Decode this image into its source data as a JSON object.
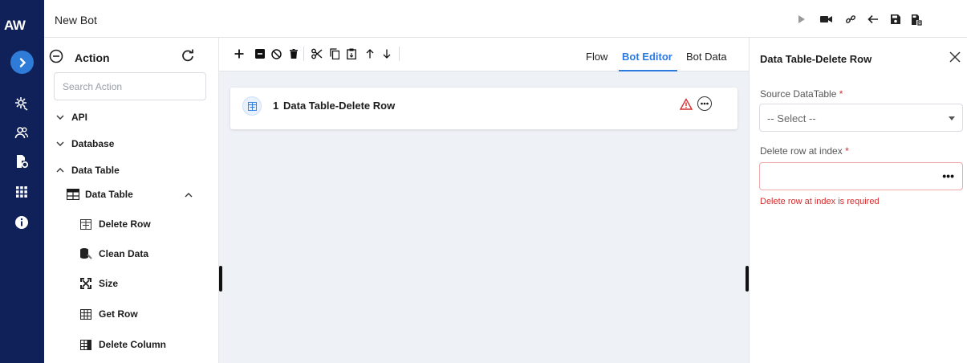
{
  "rail": {
    "logo": "AW",
    "icons": [
      "expand-icon",
      "automation-gear-icon",
      "users-icon",
      "file-settings-icon",
      "apps-grid-icon",
      "info-icon"
    ]
  },
  "topbar": {
    "title": "New Bot",
    "tools": [
      "play-icon",
      "record-icon",
      "link-icon",
      "back-arrow-icon",
      "save-icon",
      "save-as-icon"
    ]
  },
  "actions": {
    "title": "Action",
    "search_placeholder": "Search Action",
    "categories": [
      {
        "label": "API"
      },
      {
        "label": "Database"
      },
      {
        "label": "Data Table"
      }
    ],
    "subgroup": {
      "label": "Data Table"
    },
    "leaves": [
      {
        "label": "Delete Row",
        "icon": "delete-row-icon"
      },
      {
        "label": "Clean Data",
        "icon": "clean-data-icon"
      },
      {
        "label": "Size",
        "icon": "size-icon"
      },
      {
        "label": "Get Row",
        "icon": "get-row-icon"
      },
      {
        "label": "Delete Column",
        "icon": "delete-column-icon"
      }
    ]
  },
  "canvas": {
    "tabs": [
      {
        "label": "Flow",
        "active": false
      },
      {
        "label": "Bot Editor",
        "active": true
      },
      {
        "label": "Bot Data",
        "active": false
      }
    ],
    "step": {
      "number": "1",
      "label": "Data Table-Delete Row"
    }
  },
  "props": {
    "title": "Data Table-Delete Row",
    "fields": [
      {
        "label": "Source DataTable",
        "required": "*",
        "value": "-- Select --"
      },
      {
        "label": "Delete row at index",
        "required": "*",
        "value": ""
      }
    ],
    "error": "Delete row at index is required"
  },
  "colors": {
    "rail": "#0f2158",
    "accent": "#2c7ae0",
    "error": "#d32f2f"
  }
}
